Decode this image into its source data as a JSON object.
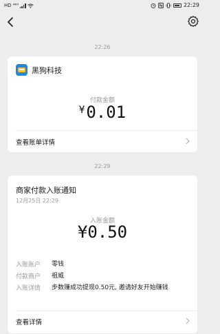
{
  "status_bar": {
    "left_indicators": "HD ⁴⁶ᴵˡ",
    "time": "22:29"
  },
  "separators": {
    "first": "22:26",
    "second": "22:29"
  },
  "payment_card": {
    "merchant": "黑狗科技",
    "amount_label": "付款金额",
    "currency": "¥",
    "amount": "0.01",
    "detail_link": "查看账单详情"
  },
  "notice_card": {
    "title": "商家付款入账通知",
    "datetime": "12月25日  22:29",
    "amount_label": "入账金额",
    "amount": "¥0.50",
    "rows": [
      {
        "key": "入账账户",
        "value": "零钱"
      },
      {
        "key": "付款商户",
        "value": "祖威"
      },
      {
        "key": "入账详情",
        "value": "步数赚成功提现0.50元, 邀请好友开始赚钱"
      }
    ],
    "detail_link": "查看详情"
  }
}
